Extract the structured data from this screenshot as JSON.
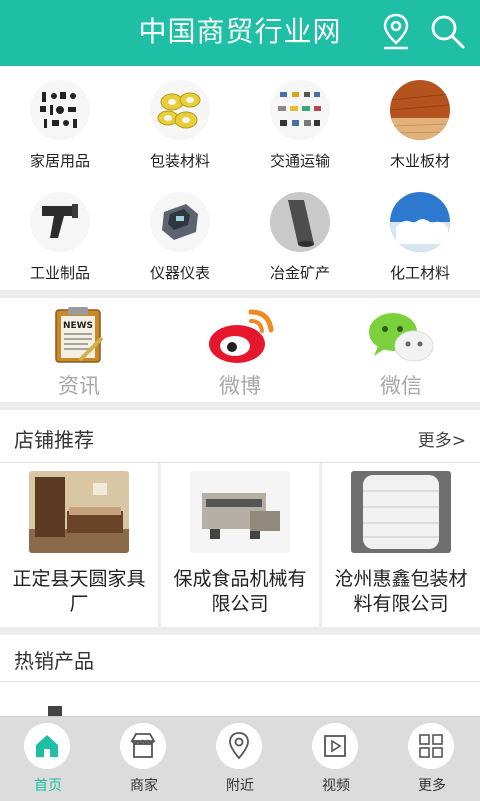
{
  "header": {
    "title": "中国商贸行业网"
  },
  "categories": [
    {
      "label": "家居用品"
    },
    {
      "label": "包装材料"
    },
    {
      "label": "交通运输"
    },
    {
      "label": "木业板材"
    },
    {
      "label": "工业制品"
    },
    {
      "label": "仪器仪表"
    },
    {
      "label": "冶金矿产"
    },
    {
      "label": "化工材料"
    }
  ],
  "social": [
    {
      "label": "资讯",
      "badge": "NEWS"
    },
    {
      "label": "微博"
    },
    {
      "label": "微信"
    }
  ],
  "shops": {
    "title": "店铺推荐",
    "more": "更多>",
    "items": [
      {
        "name": "正定县天圆家具厂"
      },
      {
        "name": "保成食品机械有限公司"
      },
      {
        "name": "沧州惠鑫包装材料有限公司"
      }
    ]
  },
  "hot": {
    "title": "热销产品"
  },
  "tabs": [
    {
      "label": "首页",
      "active": true
    },
    {
      "label": "商家"
    },
    {
      "label": "附近"
    },
    {
      "label": "视频"
    },
    {
      "label": "更多"
    }
  ],
  "colors": {
    "accent": "#1fbfa6"
  }
}
